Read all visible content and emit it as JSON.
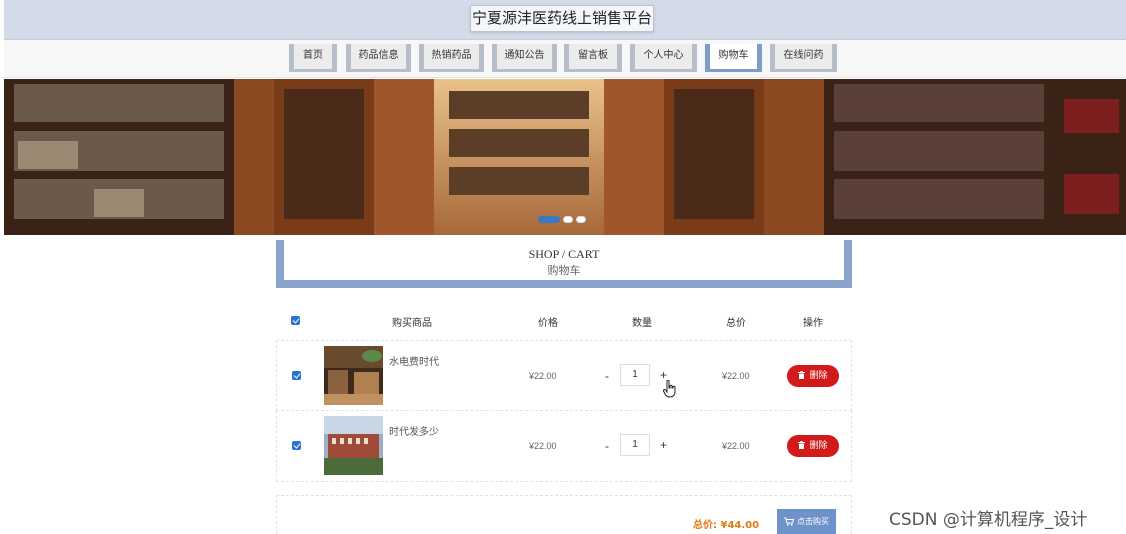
{
  "header": {
    "title": "宁夏源沣医药线上销售平台"
  },
  "nav": {
    "items": [
      {
        "label": "首页",
        "active": false
      },
      {
        "label": "药品信息",
        "active": false
      },
      {
        "label": "热销药品",
        "active": false
      },
      {
        "label": "通知公告",
        "active": false
      },
      {
        "label": "留言板",
        "active": false
      },
      {
        "label": "个人中心",
        "active": false
      },
      {
        "label": "购物车",
        "active": true
      },
      {
        "label": "在线问药",
        "active": false
      }
    ]
  },
  "banner": {
    "slide_count": 3,
    "active_slide": 1
  },
  "section": {
    "title_en": "SHOP / CART",
    "title_cn": "购物车"
  },
  "cart": {
    "headers": {
      "product": "购买商品",
      "price": "价格",
      "quantity": "数量",
      "total": "总价",
      "action": "操作"
    },
    "select_all_checked": true,
    "items": [
      {
        "name": "水电费时代",
        "price": "¥22.00",
        "quantity": "1",
        "total": "¥22.00",
        "checked": true,
        "delete_label": "删除",
        "minus": "-",
        "plus": "+"
      },
      {
        "name": "时代发多少",
        "price": "¥22.00",
        "quantity": "1",
        "total": "¥22.00",
        "checked": true,
        "delete_label": "删除",
        "minus": "-",
        "plus": "+"
      }
    ],
    "sum_label": "总价: ¥44.00",
    "buy_label": "点击购买"
  },
  "watermark": "CSDN @计算机程序_设计",
  "colors": {
    "accent": "#8aa3cb",
    "delete": "#d21a1a",
    "sum": "#e07b10",
    "buy": "#6e93c9",
    "header": "#d4dbe8"
  }
}
